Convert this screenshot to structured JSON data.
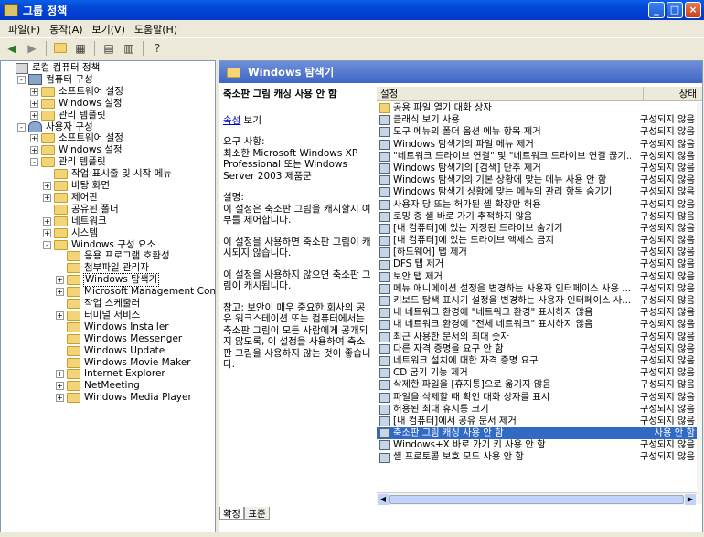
{
  "window": {
    "title": "그룹 정책"
  },
  "menu": [
    "파일(F)",
    "동작(A)",
    "보기(V)",
    "도움말(H)"
  ],
  "tree": [
    {
      "label": "로컬 컴퓨터 정책",
      "depth": 0,
      "icon": "policy-icon",
      "expander": "none"
    },
    {
      "label": "컴퓨터 구성",
      "depth": 1,
      "icon": "computer-icon",
      "expander": "-"
    },
    {
      "label": "소프트웨어 설정",
      "depth": 2,
      "icon": "folder-icon",
      "expander": "+"
    },
    {
      "label": "Windows 설정",
      "depth": 2,
      "icon": "folder-icon",
      "expander": "+"
    },
    {
      "label": "관리 템플릿",
      "depth": 2,
      "icon": "folder-icon",
      "expander": "+"
    },
    {
      "label": "사용자 구성",
      "depth": 1,
      "icon": "user-icon",
      "expander": "-"
    },
    {
      "label": "소프트웨어 설정",
      "depth": 2,
      "icon": "folder-icon",
      "expander": "+"
    },
    {
      "label": "Windows 설정",
      "depth": 2,
      "icon": "folder-icon",
      "expander": "+"
    },
    {
      "label": "관리 템플릿",
      "depth": 2,
      "icon": "folder-icon",
      "expander": "-"
    },
    {
      "label": "작업 표시줄 및 시작 메뉴",
      "depth": 3,
      "icon": "folder-icon",
      "expander": "none"
    },
    {
      "label": "바탕 화면",
      "depth": 3,
      "icon": "folder-icon",
      "expander": "+"
    },
    {
      "label": "제어판",
      "depth": 3,
      "icon": "folder-icon",
      "expander": "+"
    },
    {
      "label": "공유된 폴더",
      "depth": 3,
      "icon": "folder-icon",
      "expander": "none"
    },
    {
      "label": "네트워크",
      "depth": 3,
      "icon": "folder-icon",
      "expander": "+"
    },
    {
      "label": "시스템",
      "depth": 3,
      "icon": "folder-icon",
      "expander": "+"
    },
    {
      "label": "Windows 구성 요소",
      "depth": 3,
      "icon": "folder-icon",
      "expander": "-"
    },
    {
      "label": "응용 프로그램 호환성",
      "depth": 4,
      "icon": "folder-icon",
      "expander": "none"
    },
    {
      "label": "첨부파일 관리자",
      "depth": 4,
      "icon": "folder-icon",
      "expander": "none"
    },
    {
      "label": "Windows 탐색기",
      "depth": 4,
      "icon": "folder-icon",
      "expander": "+",
      "selected": true
    },
    {
      "label": "Microsoft Management Console",
      "depth": 4,
      "icon": "folder-icon",
      "expander": "+"
    },
    {
      "label": "작업 스케줄러",
      "depth": 4,
      "icon": "folder-icon",
      "expander": "none"
    },
    {
      "label": "터미널 서비스",
      "depth": 4,
      "icon": "folder-icon",
      "expander": "+"
    },
    {
      "label": "Windows Installer",
      "depth": 4,
      "icon": "folder-icon",
      "expander": "none"
    },
    {
      "label": "Windows Messenger",
      "depth": 4,
      "icon": "folder-icon",
      "expander": "none"
    },
    {
      "label": "Windows Update",
      "depth": 4,
      "icon": "folder-icon",
      "expander": "none"
    },
    {
      "label": "Windows Movie Maker",
      "depth": 4,
      "icon": "folder-icon",
      "expander": "none"
    },
    {
      "label": "Internet Explorer",
      "depth": 4,
      "icon": "folder-icon",
      "expander": "+"
    },
    {
      "label": "NetMeeting",
      "depth": 4,
      "icon": "folder-icon",
      "expander": "+"
    },
    {
      "label": "Windows Media Player",
      "depth": 4,
      "icon": "folder-icon",
      "expander": "+"
    }
  ],
  "panel": {
    "header": "Windows 탐색기",
    "desc_title": "축소판 그림 캐싱 사용 안 함",
    "properties_link": "속성",
    "properties_suffix": " 보기",
    "paragraphs": [
      "요구 사항:\n최소한 Microsoft Windows XP Professional 또는 Windows Server 2003 제품군",
      "설명:\n이 설정은 축소판 그림을 캐시할지 여부를 제어합니다.",
      "이 설정을 사용하면 축소판 그림이 캐시되지 않습니다.",
      "이 설정을 사용하지 않으면 축소판 그림이 캐시됩니다.",
      "참고: 보안이 매우 중요한 회사의 공유 워크스테이션 또는 컴퓨터에서는 축소판 그림이 모든 사람에게 공개되지 않도록, 이 설정을 사용하여 축소판 그림을 사용하지 않는 것이 좋습니다."
    ],
    "col_setting": "설정",
    "col_state": "상태",
    "tabs": [
      "확장",
      "표준"
    ]
  },
  "settings": [
    {
      "name": "공용 파일 열기 대화 상자",
      "state": "",
      "folder": true
    },
    {
      "name": "클래식 보기 사용",
      "state": "구성되지 않음"
    },
    {
      "name": "도구 메뉴의 폴더 옵션 메뉴 항목 제거",
      "state": "구성되지 않음"
    },
    {
      "name": "Windows 탐색기의 파일 메뉴 제거",
      "state": "구성되지 않음"
    },
    {
      "name": "\"네트워크 드라이브 연결\" 및 \"네트워크 드라이브 연결 끊기...",
      "state": "구성되지 않음"
    },
    {
      "name": "Windows 탐색기의 [검색] 단추 제거",
      "state": "구성되지 않음"
    },
    {
      "name": "Windows 탐색기의 기본 상황에 맞는 메뉴 사용 안 함",
      "state": "구성되지 않음"
    },
    {
      "name": "Windows 탐색기 상황에 맞는 메뉴의 관리 항목 숨기기",
      "state": "구성되지 않음"
    },
    {
      "name": "사용자 당 또는 허가된 셸 확장만 허용",
      "state": "구성되지 않음"
    },
    {
      "name": "로밍 중 셸 바로 가기 추적하지 않음",
      "state": "구성되지 않음"
    },
    {
      "name": "[내 컴퓨터]에 있는 지정된 드라이브 숨기기",
      "state": "구성되지 않음"
    },
    {
      "name": "[내 컴퓨터]에 있는 드라이브 액세스 금지",
      "state": "구성되지 않음"
    },
    {
      "name": "[하드웨어] 탭 제거",
      "state": "구성되지 않음"
    },
    {
      "name": "DFS 탭 제거",
      "state": "구성되지 않음"
    },
    {
      "name": "보안 탭 제거",
      "state": "구성되지 않음"
    },
    {
      "name": "메뉴 애니메이션 설정을 변경하는 사용자 인터페이스 사용 ...",
      "state": "구성되지 않음"
    },
    {
      "name": "키보드 탐색 표시기 설정을 변경하는 사용자 인터페이스 사...",
      "state": "구성되지 않음"
    },
    {
      "name": "내 네트워크 환경에 \"네트워크 환경\" 표시하지 않음",
      "state": "구성되지 않음"
    },
    {
      "name": "내 네트워크 환경에 \"전체 네트워크\" 표시하지 않음",
      "state": "구성되지 않음"
    },
    {
      "name": "최근 사용한 문서의 최대 숫자",
      "state": "구성되지 않음"
    },
    {
      "name": "다른 자격 증명을 요구 안 함",
      "state": "구성되지 않음"
    },
    {
      "name": "네트워크 설치에 대한 자격 증명 요구",
      "state": "구성되지 않음"
    },
    {
      "name": "CD 굽기 기능 제거",
      "state": "구성되지 않음"
    },
    {
      "name": "삭제한 파일을 [휴지통]으로 옮기지 않음",
      "state": "구성되지 않음"
    },
    {
      "name": "파일을 삭제할 때 확인 대화 상자를 표시",
      "state": "구성되지 않음"
    },
    {
      "name": "허용된 최대 휴지통 크기",
      "state": "구성되지 않음"
    },
    {
      "name": "[내 컴퓨터]에서 공유 문서 제거",
      "state": "구성되지 않음"
    },
    {
      "name": "축소판 그림 캐싱 사용 안 함",
      "state": "사용 안 함",
      "selected": true
    },
    {
      "name": "Windows+X 바로 가기 키 사용 안 함",
      "state": "구성되지 않음"
    },
    {
      "name": "셸 프로토콜 보호 모드 사용 안 함",
      "state": "구성되지 않음"
    }
  ]
}
